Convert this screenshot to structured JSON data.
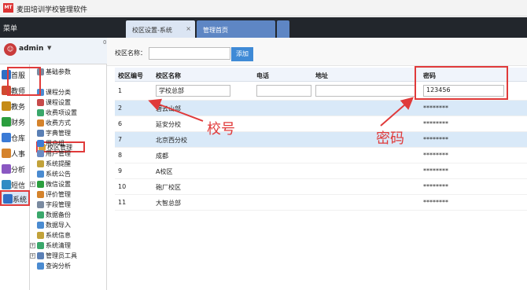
{
  "window": {
    "title": "麦田培训学校管理软件",
    "logo_text": "MT"
  },
  "topbar": {
    "menu_label": "菜单",
    "tabs": [
      {
        "label": "校区设置-系统",
        "close": "×"
      },
      {
        "label": "管理首页"
      }
    ]
  },
  "user": {
    "name": "admin",
    "caret": "▼",
    "avatar": "☺",
    "pin": "0"
  },
  "sidebar": {
    "categories": [
      {
        "label": "首服",
        "color": "#2f6fc4"
      },
      {
        "label": "教师",
        "color": "#d04a2f"
      },
      {
        "label": "教务",
        "color": "#c58b16"
      },
      {
        "label": "财务",
        "color": "#2b9e3e"
      },
      {
        "label": "仓库",
        "color": "#3b7bd6"
      },
      {
        "label": "人事",
        "color": "#d5832c"
      },
      {
        "label": "分析",
        "color": "#8a58c2"
      },
      {
        "label": "短信",
        "color": "#2f8cc4"
      },
      {
        "label": "系统",
        "color": "#2f6fc4"
      }
    ]
  },
  "tree": {
    "items": [
      {
        "label": "基础参数",
        "color": "#7a8aa0"
      },
      {
        "label": "校区管理",
        "color": "#d9a33a"
      },
      {
        "label": "课程分类",
        "color": "#4a8bd1"
      },
      {
        "label": "课程设置",
        "color": "#c74a4a"
      },
      {
        "label": "收费项设置",
        "color": "#3aa76b"
      },
      {
        "label": "收费方式",
        "color": "#d5832c"
      },
      {
        "label": "字典管理",
        "color": "#5a7fb5"
      },
      {
        "label": "用户组",
        "color": "#3b7bd6"
      },
      {
        "label": "用户管理",
        "color": "#6b8bc3"
      },
      {
        "label": "系统提醒",
        "color": "#c2a23a"
      },
      {
        "label": "系统公告",
        "color": "#4a8bd1"
      },
      {
        "label": "微信设置",
        "color": "#2b9e3e"
      },
      {
        "label": "评价管理",
        "color": "#d5832c"
      },
      {
        "label": "字段管理",
        "color": "#7a8aa0"
      },
      {
        "label": "数据备份",
        "color": "#3aa76b"
      },
      {
        "label": "数据导入",
        "color": "#4a8bd1"
      },
      {
        "label": "系统信息",
        "color": "#c2a23a"
      },
      {
        "label": "系统清理",
        "color": "#3aa76b"
      },
      {
        "label": "管理员工具",
        "color": "#5a7fb5"
      },
      {
        "label": "查询分析",
        "color": "#4a8bd1"
      }
    ]
  },
  "search": {
    "label": "校区名称：",
    "value": "",
    "button": "添加"
  },
  "table": {
    "headers": [
      "校区编号",
      "校区名称",
      "电话",
      "地址",
      "密码"
    ],
    "rows": [
      [
        "1",
        "学校总部",
        "",
        "",
        "123456"
      ],
      [
        "2",
        "碧云山部",
        "",
        "",
        "********"
      ],
      [
        "6",
        "延安分校",
        "",
        "",
        "********"
      ],
      [
        "7",
        "北京西分校",
        "",
        "",
        "********"
      ],
      [
        "8",
        "成都",
        "",
        "",
        "********"
      ],
      [
        "9",
        "A校区",
        "",
        "",
        "********"
      ],
      [
        "10",
        "砲厂校区",
        "",
        "",
        "********"
      ],
      [
        "11",
        "大智总部",
        "",
        "",
        "********"
      ]
    ]
  },
  "annotations": {
    "code": "校号",
    "password": "密码",
    "color": "#e03a3a"
  }
}
